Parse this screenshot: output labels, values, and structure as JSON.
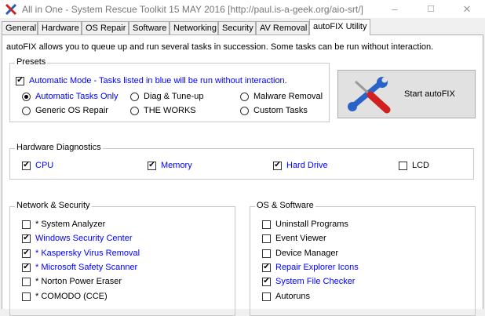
{
  "window": {
    "title": "All in One - System Rescue Toolkit 15 MAY 2016 [http://paul.is-a-geek.org/aio-srt/]",
    "minimize": "–",
    "maximize": "☐",
    "close": "✕"
  },
  "tabs": [
    {
      "label": "General"
    },
    {
      "label": "Hardware"
    },
    {
      "label": "OS Repair"
    },
    {
      "label": "Software"
    },
    {
      "label": "Networking"
    },
    {
      "label": "Security"
    },
    {
      "label": "AV Removal"
    },
    {
      "label": "autoFIX Utility",
      "active": true
    }
  ],
  "description": "autoFIX allows you to queue up and run several tasks in succession.  Some tasks can be run without interaction.",
  "presets": {
    "legend": "Presets",
    "automatic_mode": {
      "label": "Automatic Mode - Tasks listed in blue will be run without interaction.",
      "checked": true,
      "color": "#0000ff"
    },
    "options": [
      {
        "label": "Automatic Tasks Only",
        "selected": true,
        "blue": true
      },
      {
        "label": "Diag & Tune-up",
        "selected": false,
        "blue": false
      },
      {
        "label": "Malware Removal",
        "selected": false,
        "blue": false
      },
      {
        "label": "Generic OS Repair",
        "selected": false,
        "blue": false
      },
      {
        "label": "THE WORKS",
        "selected": false,
        "blue": false
      },
      {
        "label": "Custom Tasks",
        "selected": false,
        "blue": false
      }
    ]
  },
  "start_button": {
    "label": "Start autoFIX",
    "icon": "wrench-screwdriver-icon"
  },
  "hardware": {
    "legend": "Hardware Diagnostics",
    "items": [
      {
        "label": "CPU",
        "checked": true,
        "blue": true
      },
      {
        "label": "Memory",
        "checked": true,
        "blue": true
      },
      {
        "label": "Hard Drive",
        "checked": true,
        "blue": true
      },
      {
        "label": "LCD",
        "checked": false,
        "blue": false
      }
    ]
  },
  "network": {
    "legend": "Network & Security",
    "items": [
      {
        "label": "* System Analyzer",
        "checked": false,
        "blue": false
      },
      {
        "label": "Windows Security Center",
        "checked": true,
        "blue": true
      },
      {
        "label": "* Kaspersky Virus Removal",
        "checked": true,
        "blue": true
      },
      {
        "label": "* Microsoft Safety Scanner",
        "checked": true,
        "blue": true
      },
      {
        "label": "* Norton Power Eraser",
        "checked": false,
        "blue": false
      },
      {
        "label": "* COMODO (CCE)",
        "checked": false,
        "blue": false
      }
    ]
  },
  "os": {
    "legend": "OS & Software",
    "items": [
      {
        "label": "Uninstall Programs",
        "checked": false,
        "blue": false
      },
      {
        "label": "Event Viewer",
        "checked": false,
        "blue": false
      },
      {
        "label": "Device Manager",
        "checked": false,
        "blue": false
      },
      {
        "label": "Repair Explorer Icons",
        "checked": true,
        "blue": true
      },
      {
        "label": "System File Checker",
        "checked": true,
        "blue": true
      },
      {
        "label": "Autoruns",
        "checked": false,
        "blue": false
      }
    ]
  }
}
